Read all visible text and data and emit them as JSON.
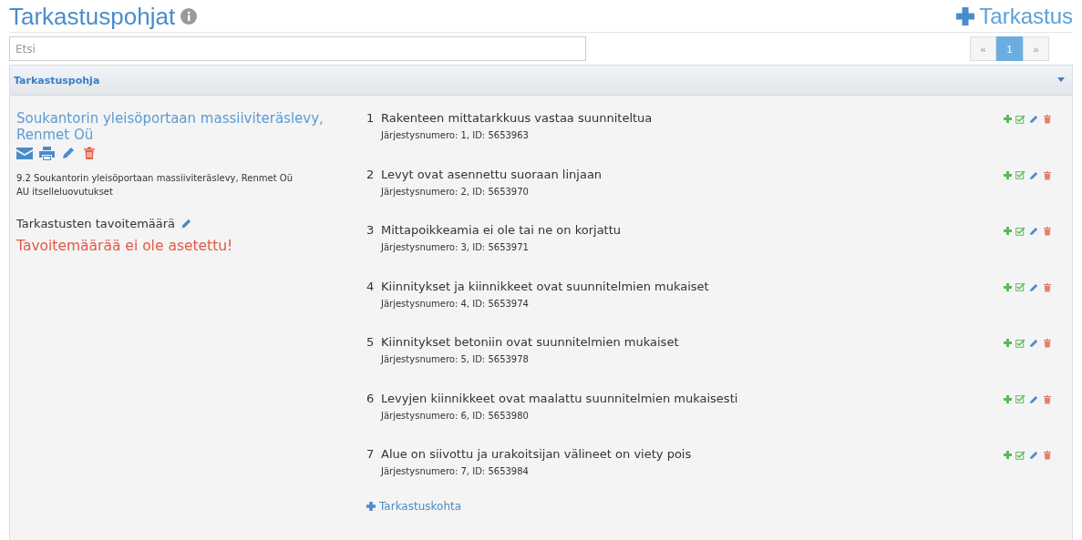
{
  "header": {
    "title": "Tarkastuspohjat",
    "add_button": "Tarkastus"
  },
  "search": {
    "placeholder": "Etsi"
  },
  "pagination": [
    {
      "label": "«",
      "selected": false
    },
    {
      "label": "1",
      "selected": true
    },
    {
      "label": "»",
      "selected": false
    }
  ],
  "panel": {
    "title": "Tarkastuspohja",
    "expanded": true
  },
  "template": {
    "name": "Soukantorin yleisöportaan massiiviteräslevy, Renmet Oü",
    "details": [
      "9.2 Soukantorin yleisöportaan massiiviteräslevy, Renmet Oü",
      "AU itselleluovutukset"
    ],
    "target_label": "Tarkastusten tavoitemäärä",
    "target_warning": "Tavoitemäärää ei ole asetettu!"
  },
  "items": [
    {
      "number": "1",
      "title": "Rakenteen mittatarkkuus vastaa suunniteltua",
      "meta": "Järjestysnumero: 1, ID: 5653963"
    },
    {
      "number": "2",
      "title": "Levyt ovat asennettu suoraan linjaan",
      "meta": "Järjestysnumero: 2, ID: 5653970"
    },
    {
      "number": "3",
      "title": "Mittapoikkeamia ei ole tai ne on korjattu",
      "meta": "Järjestysnumero: 3, ID: 5653971"
    },
    {
      "number": "4",
      "title": "Kiinnitykset ja kiinnikkeet ovat suunnitelmien mukaiset",
      "meta": "Järjestysnumero: 4, ID: 5653974"
    },
    {
      "number": "5",
      "title": "Kiinnitykset betoniin ovat suunnitelmien mukaiset",
      "meta": "Järjestysnumero: 5, ID: 5653978"
    },
    {
      "number": "6",
      "title": "Levyjen kiinnikkeet ovat maalattu suunnitelmien mukaisesti",
      "meta": "Järjestysnumero: 6, ID: 5653980"
    },
    {
      "number": "7",
      "title": "Alue on siivottu ja urakoitsijan välineet on viety pois",
      "meta": "Järjestysnumero: 7, ID: 5653984"
    }
  ],
  "add_item_button": "Tarkastuskohta"
}
